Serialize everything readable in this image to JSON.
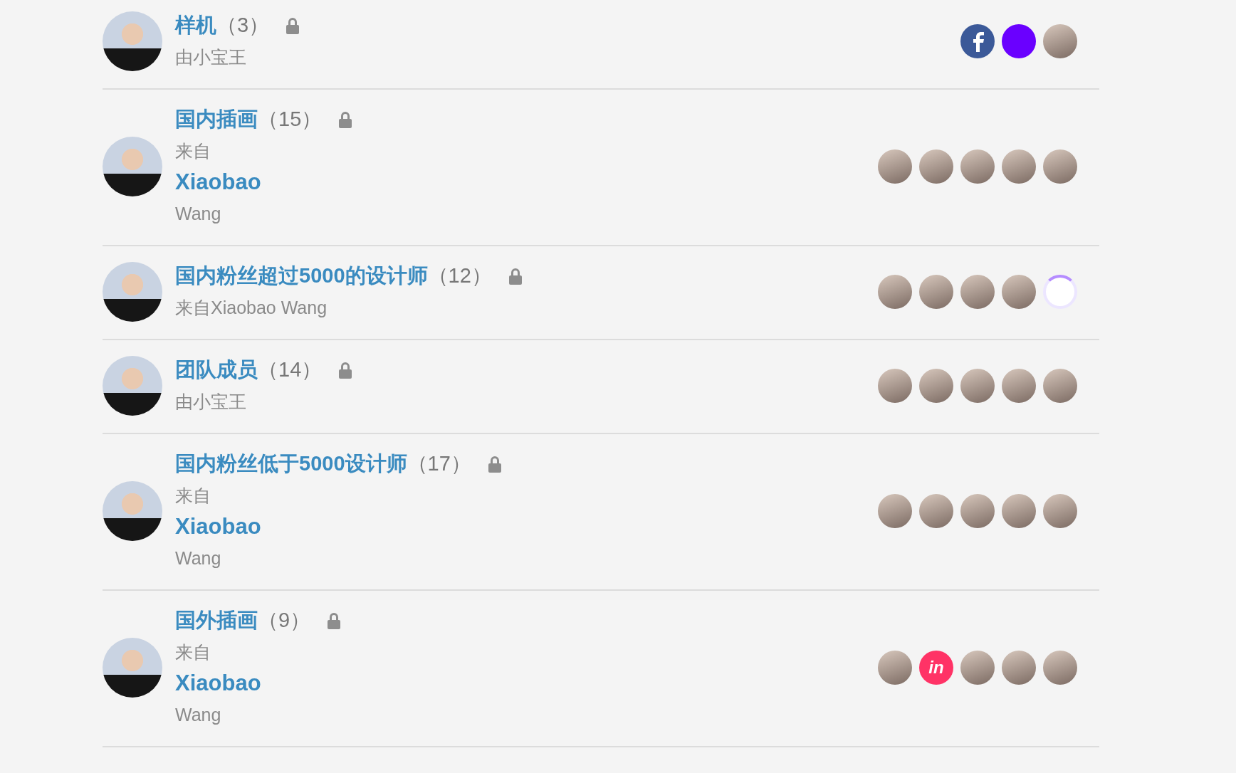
{
  "groups": [
    {
      "title": "样机",
      "count": "（3）",
      "locked": true,
      "byline": {
        "kind": "plain",
        "text": "由小宝王"
      },
      "members": [
        {
          "kind": "facebook"
        },
        {
          "kind": "plain"
        },
        {
          "kind": "photo"
        }
      ]
    },
    {
      "title": "国内插画",
      "count": "（15）",
      "locked": true,
      "byline": {
        "kind": "stacked",
        "prefix": "来自",
        "name": "Xiaobao",
        "suffix": "Wang"
      },
      "members": [
        {
          "kind": "photo"
        },
        {
          "kind": "photo"
        },
        {
          "kind": "photo"
        },
        {
          "kind": "photo"
        },
        {
          "kind": "photo"
        }
      ]
    },
    {
      "title": "国内粉丝超过5000的设计师",
      "count": "（12）",
      "locked": true,
      "byline": {
        "kind": "plain",
        "text": "来自Xiaobao Wang"
      },
      "members": [
        {
          "kind": "photo"
        },
        {
          "kind": "photo"
        },
        {
          "kind": "photo"
        },
        {
          "kind": "photo"
        },
        {
          "kind": "ring"
        }
      ]
    },
    {
      "title": "团队成员",
      "count": "（14）",
      "locked": true,
      "byline": {
        "kind": "plain",
        "text": "由小宝王"
      },
      "members": [
        {
          "kind": "photo"
        },
        {
          "kind": "photo"
        },
        {
          "kind": "photo"
        },
        {
          "kind": "photo"
        },
        {
          "kind": "photo"
        }
      ]
    },
    {
      "title": "国内粉丝低于5000设计师",
      "count": "（17）",
      "locked": true,
      "byline": {
        "kind": "stacked",
        "prefix": "来自",
        "name": "Xiaobao",
        "suffix": "Wang"
      },
      "members": [
        {
          "kind": "photo"
        },
        {
          "kind": "photo"
        },
        {
          "kind": "photo"
        },
        {
          "kind": "photo"
        },
        {
          "kind": "photo"
        }
      ]
    },
    {
      "title": "国外插画",
      "count": "（9）",
      "locked": true,
      "byline": {
        "kind": "stacked",
        "prefix": "来自",
        "name": "Xiaobao",
        "suffix": "Wang"
      },
      "members": [
        {
          "kind": "photo"
        },
        {
          "kind": "logo",
          "text": "in"
        },
        {
          "kind": "photo"
        },
        {
          "kind": "photo"
        },
        {
          "kind": "photo"
        }
      ]
    }
  ]
}
